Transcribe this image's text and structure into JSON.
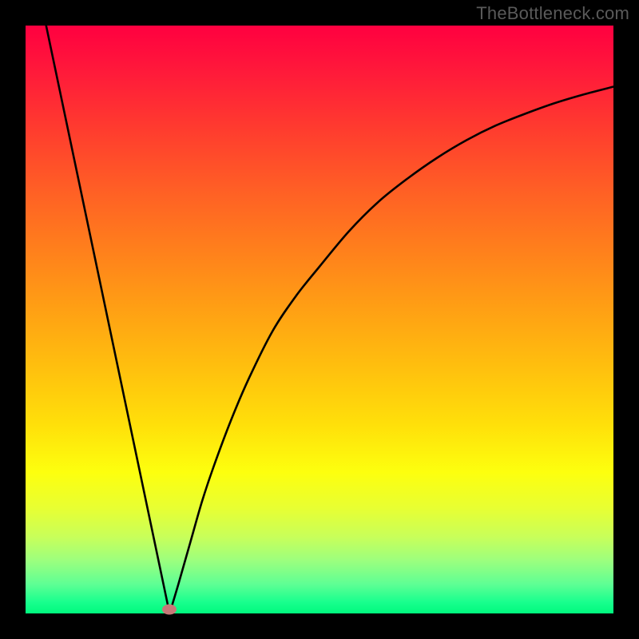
{
  "watermark": "TheBottleneck.com",
  "colors": {
    "frame": "#000000",
    "curve": "#000000",
    "marker": "#c77878"
  },
  "chart_data": {
    "type": "line",
    "title": "",
    "xlabel": "",
    "ylabel": "",
    "xlim": [
      0,
      100
    ],
    "ylim": [
      0,
      100
    ],
    "grid": false,
    "series": [
      {
        "name": "left-segment",
        "x": [
          3.5,
          24.5
        ],
        "values": [
          100,
          0
        ]
      },
      {
        "name": "right-curve",
        "x": [
          24.5,
          26,
          28,
          30,
          32,
          35,
          38,
          42,
          46,
          50,
          55,
          60,
          65,
          70,
          75,
          80,
          85,
          90,
          95,
          100
        ],
        "values": [
          0,
          5,
          12,
          19,
          25,
          33,
          40,
          48,
          54,
          59,
          65,
          70,
          74,
          77.5,
          80.5,
          83,
          85,
          86.8,
          88.3,
          89.6
        ]
      }
    ],
    "annotations": [
      {
        "name": "vertex-marker",
        "x": 24.5,
        "y": 0.7
      }
    ]
  }
}
